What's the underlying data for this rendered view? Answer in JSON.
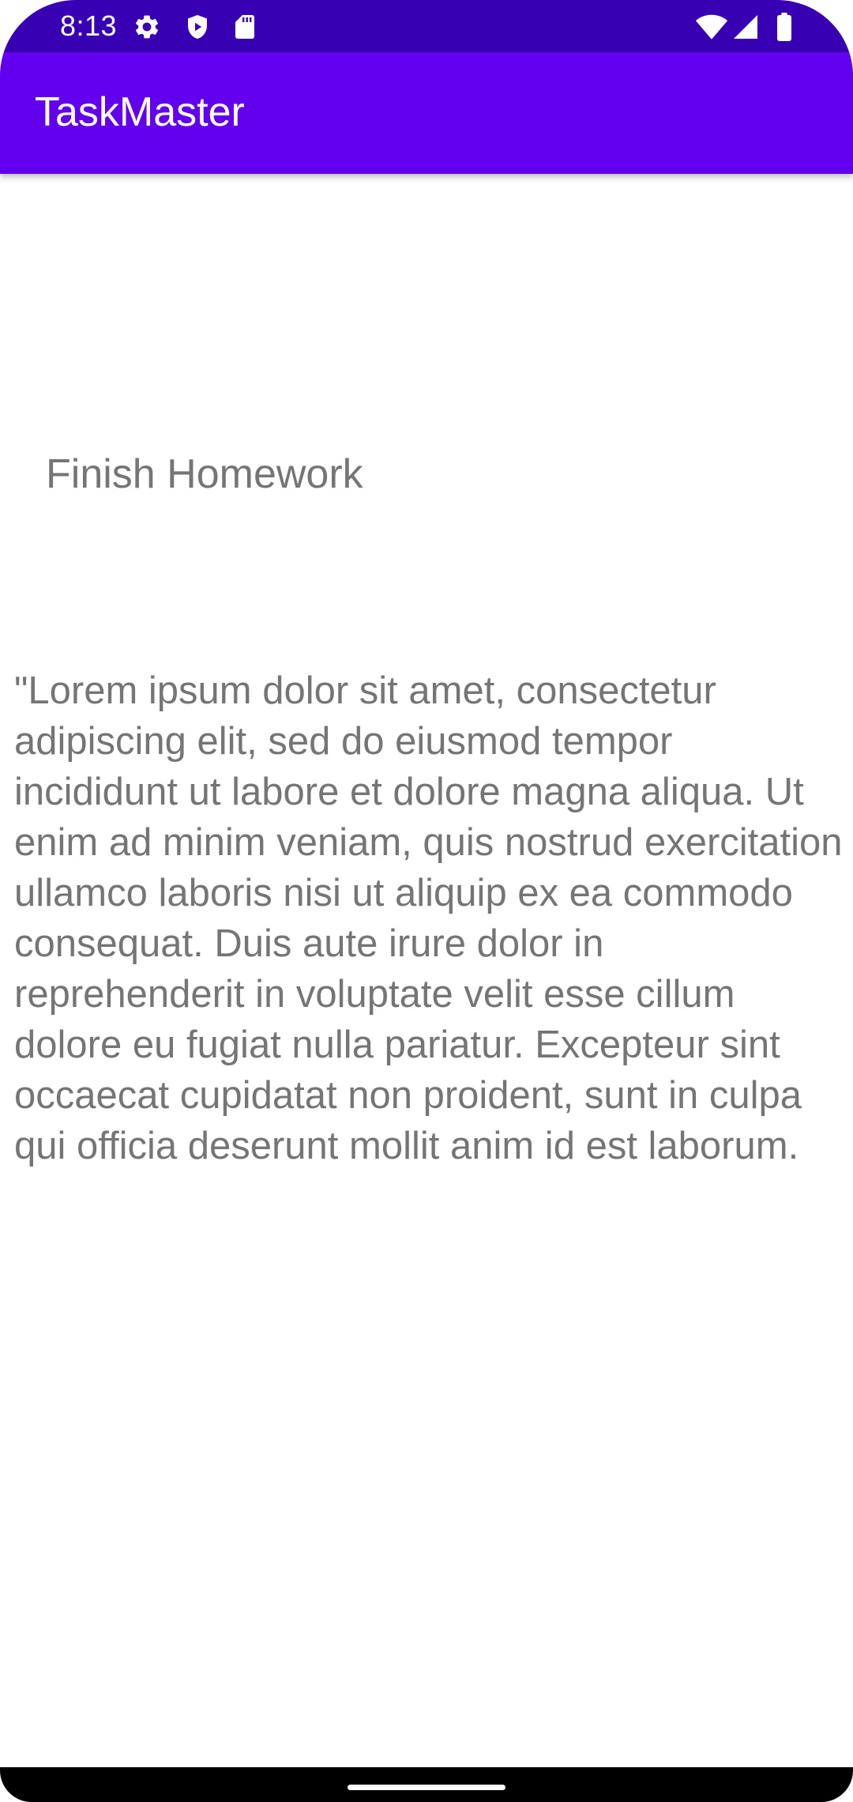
{
  "status_bar": {
    "time": "8:13",
    "left_icons": [
      "settings-icon",
      "play-protect-icon",
      "sd-card-icon"
    ],
    "right_icons": [
      "wifi-icon",
      "signal-icon",
      "battery-icon"
    ],
    "background": "#3700b3"
  },
  "app_bar": {
    "title": "TaskMaster",
    "background": "#6200ee"
  },
  "task": {
    "title": "Finish Homework",
    "body": "\"Lorem ipsum dolor sit amet, consectetur adipiscing elit, sed do eiusmod tempor incididunt ut labore et dolore magna aliqua. Ut enim ad minim veniam, quis nostrud exercitation ullamco laboris nisi ut aliquip ex ea commodo consequat. Duis aute irure dolor in reprehenderit in voluptate velit esse cillum dolore eu fugiat nulla pariatur. Excepteur sint occaecat cupidatat non proident, sunt in culpa qui officia deserunt mollit anim id est laborum.",
    "text_color": "#757575"
  },
  "nav_bar": {
    "handle": "gesture-handle"
  }
}
